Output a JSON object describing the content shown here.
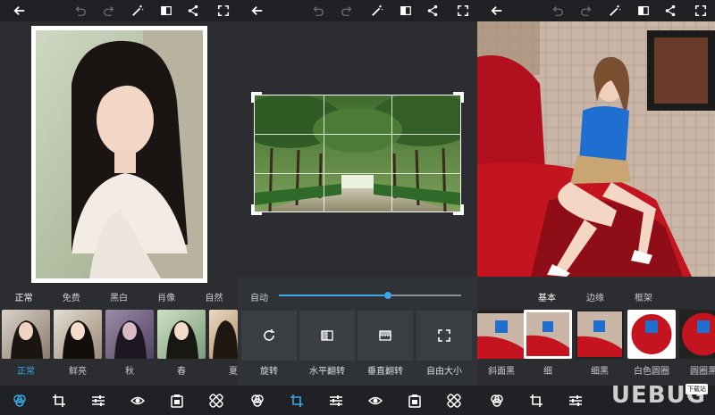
{
  "colors": {
    "accent": "#3aa6e8",
    "background": "#2b2d31",
    "bar": "#1f2124"
  },
  "panel1": {
    "topbar_icons": [
      "back-icon",
      "undo-icon",
      "redo-icon",
      "magic-wand-icon",
      "compare-icon",
      "share-icon",
      "fullscreen-icon"
    ],
    "categories": [
      "正常",
      "免费",
      "黑白",
      "肖像",
      "自然"
    ],
    "filters": [
      "正常",
      "鲜亮",
      "秋",
      "春",
      "夏"
    ]
  },
  "panel2": {
    "auto_label": "自动",
    "slider_value": 0.6,
    "tools": [
      "旋转",
      "水平翻转",
      "垂直翻转",
      "自由大小"
    ]
  },
  "panel3": {
    "tabs": [
      "基本",
      "边缘",
      "框架"
    ],
    "frames": [
      "斜面黑",
      "细",
      "细黑",
      "白色圆圈",
      "圆圈黑"
    ]
  },
  "bottom_icons": [
    "filter-icon",
    "crop-icon",
    "adjust-icon",
    "eye-icon",
    "frame-icon",
    "healing-icon"
  ],
  "watermark": {
    "text": "UEBUG",
    "badge": "下载站"
  }
}
